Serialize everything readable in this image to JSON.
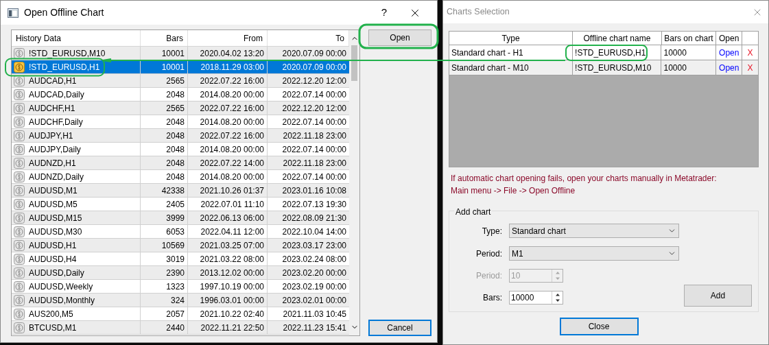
{
  "offline_dialog": {
    "title": "Open Offline Chart",
    "help": "?",
    "table": {
      "columns": [
        "History Data",
        "Bars",
        "From",
        "To"
      ],
      "rows": [
        {
          "symbol": "!STD_EURUSD,M10",
          "bars": "10001",
          "from": "2020.04.02 13:20",
          "to": "2020.07.09 00:00",
          "selected": false
        },
        {
          "symbol": "!STD_EURUSD,H1",
          "bars": "10001",
          "from": "2018.11.29 03:00",
          "to": "2020.07.09 00:00",
          "selected": true
        },
        {
          "symbol": "AUDCAD,H1",
          "bars": "2565",
          "from": "2022.07.22 16:00",
          "to": "2022.12.20 12:00",
          "selected": false
        },
        {
          "symbol": "AUDCAD,Daily",
          "bars": "2048",
          "from": "2014.08.20 00:00",
          "to": "2022.07.14 00:00",
          "selected": false
        },
        {
          "symbol": "AUDCHF,H1",
          "bars": "2565",
          "from": "2022.07.22 16:00",
          "to": "2022.12.20 12:00",
          "selected": false
        },
        {
          "symbol": "AUDCHF,Daily",
          "bars": "2048",
          "from": "2014.08.20 00:00",
          "to": "2022.07.14 00:00",
          "selected": false
        },
        {
          "symbol": "AUDJPY,H1",
          "bars": "2048",
          "from": "2022.07.22 16:00",
          "to": "2022.11.18 23:00",
          "selected": false
        },
        {
          "symbol": "AUDJPY,Daily",
          "bars": "2048",
          "from": "2014.08.20 00:00",
          "to": "2022.07.14 00:00",
          "selected": false
        },
        {
          "symbol": "AUDNZD,H1",
          "bars": "2048",
          "from": "2022.07.22 14:00",
          "to": "2022.11.18 23:00",
          "selected": false
        },
        {
          "symbol": "AUDNZD,Daily",
          "bars": "2048",
          "from": "2014.08.20 00:00",
          "to": "2022.07.14 00:00",
          "selected": false
        },
        {
          "symbol": "AUDUSD,M1",
          "bars": "42338",
          "from": "2021.10.26 01:37",
          "to": "2023.01.16 10:08",
          "selected": false
        },
        {
          "symbol": "AUDUSD,M5",
          "bars": "2405",
          "from": "2022.07.01 11:10",
          "to": "2022.07.13 19:30",
          "selected": false
        },
        {
          "symbol": "AUDUSD,M15",
          "bars": "3999",
          "from": "2022.06.13 06:00",
          "to": "2022.08.09 21:30",
          "selected": false
        },
        {
          "symbol": "AUDUSD,M30",
          "bars": "6053",
          "from": "2022.04.11 12:00",
          "to": "2022.10.04 14:00",
          "selected": false
        },
        {
          "symbol": "AUDUSD,H1",
          "bars": "10569",
          "from": "2021.03.25 07:00",
          "to": "2023.03.17 23:00",
          "selected": false
        },
        {
          "symbol": "AUDUSD,H4",
          "bars": "3019",
          "from": "2021.03.22 08:00",
          "to": "2023.02.24 08:00",
          "selected": false
        },
        {
          "symbol": "AUDUSD,Daily",
          "bars": "2390",
          "from": "2013.12.02 00:00",
          "to": "2023.02.20 00:00",
          "selected": false
        },
        {
          "symbol": "AUDUSD,Weekly",
          "bars": "1323",
          "from": "1997.10.19 00:00",
          "to": "2023.02.19 00:00",
          "selected": false
        },
        {
          "symbol": "AUDUSD,Monthly",
          "bars": "324",
          "from": "1996.03.01 00:00",
          "to": "2023.02.01 00:00",
          "selected": false
        },
        {
          "symbol": "AUS200,M5",
          "bars": "2057",
          "from": "2021.10.22 02:40",
          "to": "2021.11.03 10:45",
          "selected": false
        },
        {
          "symbol": "BTCUSD,M1",
          "bars": "2440",
          "from": "2022.11.21 22:50",
          "to": "2022.11.23 15:41",
          "selected": false
        }
      ]
    },
    "buttons": {
      "open": "Open",
      "cancel": "Cancel"
    }
  },
  "charts_dialog": {
    "title": "Charts Selection",
    "table": {
      "columns": [
        "Type",
        "Offline chart name",
        "Bars on chart",
        "Open"
      ],
      "rows": [
        {
          "type": "Standard chart - H1",
          "name": "!STD_EURUSD,H1",
          "bars": "10000",
          "open": "Open",
          "delete": "X"
        },
        {
          "type": "Standard chart - M10",
          "name": "!STD_EURUSD,M10",
          "bars": "10000",
          "open": "Open",
          "delete": "X"
        }
      ]
    },
    "notes": [
      "If automatic chart opening fails, open your charts manually in Metatrader:",
      "Main menu -> File -> Open Offline"
    ],
    "add_chart": {
      "title": "Add chart",
      "fields": [
        {
          "kind": "select",
          "label": "Type:",
          "value": "Standard chart",
          "disabled": false
        },
        {
          "kind": "select",
          "label": "Period:",
          "value": "M1",
          "disabled": false
        },
        {
          "kind": "spin",
          "label": "Period:",
          "value": "10",
          "disabled": true
        },
        {
          "kind": "spin",
          "label": "Bars:",
          "value": "10000",
          "disabled": false
        }
      ],
      "add_button": "Add"
    },
    "close_button": "Close"
  }
}
